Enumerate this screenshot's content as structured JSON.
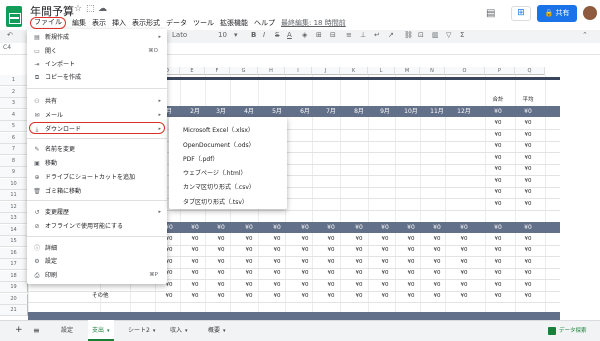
{
  "app": {
    "title": "年間予算",
    "menus": [
      "ファイル",
      "編集",
      "表示",
      "挿入",
      "表示形式",
      "データ",
      "ツール",
      "拡張機能",
      "ヘルプ"
    ],
    "last_edit": "最終編集: 18 時間前",
    "share_label": "共有"
  },
  "toolbar": {
    "undo": "↶",
    "font": "Lato",
    "font_size": "10"
  },
  "cell_ref": "C4",
  "grid": {
    "columns": [
      "A",
      "B",
      "C",
      "D",
      "E",
      "F",
      "G",
      "H",
      "I",
      "J",
      "K",
      "L",
      "M",
      "N",
      "O",
      "P",
      "Q"
    ],
    "rows": [
      "1",
      "2",
      "3",
      "4",
      "5",
      "6",
      "7",
      "8",
      "9",
      "10",
      "11",
      "12",
      "13",
      "14",
      "15",
      "16",
      "17",
      "18",
      "19",
      "20",
      "21"
    ],
    "month_headers": [
      "月",
      "2月",
      "3月",
      "4月",
      "5月",
      "6月",
      "7月",
      "8月",
      "9月",
      "10月",
      "11月",
      "12月"
    ],
    "col_total": "合計",
    "col_avg": "平均",
    "zero": "¥0",
    "bottom_label": "その他"
  },
  "file_menu": {
    "items": [
      {
        "icon": "▤",
        "label": "新規作成",
        "arrow": "▸"
      },
      {
        "icon": "▭",
        "label": "開く",
        "shortcut": "⌘O"
      },
      {
        "icon": "⇥",
        "label": "インポート"
      },
      {
        "icon": "⧉",
        "label": "コピーを作成"
      },
      {
        "icon": "⚇",
        "label": "共有",
        "arrow": "▸"
      },
      {
        "icon": "✉",
        "label": "メール",
        "arrow": "▸"
      },
      {
        "icon": "⤓",
        "label": "ダウンロード",
        "arrow": "▸"
      },
      {
        "icon": "✎",
        "label": "名前を変更"
      },
      {
        "icon": "▣",
        "label": "移動"
      },
      {
        "icon": "⊕",
        "label": "ドライブにショートカットを追加"
      },
      {
        "icon": "🗑",
        "label": "ゴミ箱に移動"
      },
      {
        "icon": "↺",
        "label": "変更履歴",
        "arrow": "▸"
      },
      {
        "icon": "⊘",
        "label": "オフラインで使用可能にする"
      },
      {
        "icon": "ⓘ",
        "label": "詳細"
      },
      {
        "icon": "⚙",
        "label": "設定"
      },
      {
        "icon": "⎙",
        "label": "印刷",
        "shortcut": "⌘P"
      }
    ]
  },
  "download_menu": {
    "items": [
      "Microsoft Excel（.xlsx）",
      "OpenDocument（.ods）",
      "PDF（.pdf）",
      "ウェブページ（.html）",
      "カンマ区切り形式（.csv）",
      "タブ区切り形式（.tsv）"
    ]
  },
  "sheet_tabs": {
    "add": "+",
    "list": "≡",
    "tabs": [
      "設定",
      "支出",
      "シート2",
      "収入",
      "概要"
    ],
    "active": "支出",
    "explore": "データ探索"
  },
  "colors": {
    "header_navy": "#39455c",
    "header_slate": "#637089",
    "accent_green": "#188038",
    "share_blue": "#1a73e8",
    "highlight_red": "#d93025"
  }
}
